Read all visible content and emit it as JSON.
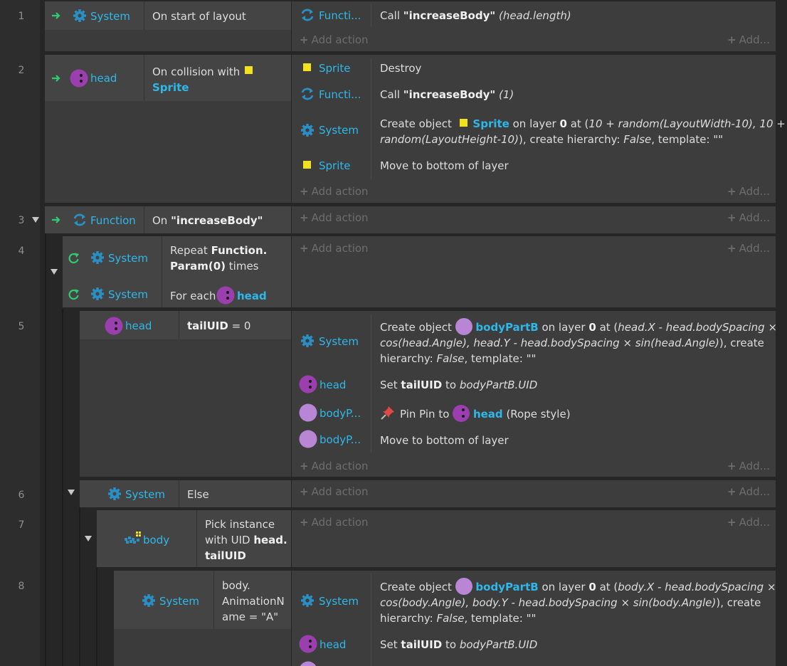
{
  "rows": [
    "1",
    "2",
    "3",
    "4",
    "5",
    "6",
    "7",
    "8"
  ],
  "objects": {
    "system": "System",
    "head": "head",
    "function": "Function",
    "functi": "Functi...",
    "sprite": "Sprite",
    "body": "body",
    "bodyp": "bodyP..."
  },
  "add_action": "Add action",
  "add_short": "Add...",
  "ev1": {
    "cond": "On start of layout",
    "act_call": "Call",
    "act_fn": "\"increaseBody\"",
    "act_arg": "(head.length)"
  },
  "ev2": {
    "cond_a": "On collision with",
    "cond_b": "Sprite",
    "a1": "Destroy",
    "a2_call": "Call",
    "a2_fn": "\"increaseBody\"",
    "a2_arg": "(1)",
    "a3_l1a": "Create object",
    "a3_obj": "Sprite",
    "a3_l1b": "on layer",
    "a3_layer": "0",
    "a3_l1c": "at (",
    "a3_l1d": "10 + random(LayoutWidth-10), 10 +",
    "a3_l2a": "random(LayoutHeight-10)",
    "a3_l2b": "), create hierarchy:",
    "a3_false": "False",
    "a3_l2c": ", template: \"\"",
    "a4": "Move to bottom of layer"
  },
  "ev3": {
    "cond_on": "On",
    "cond_fn": "\"increaseBody\""
  },
  "ev4": {
    "c1_a": "Repeat",
    "c1_b": "Function.",
    "c1_c": "Param(0)",
    "c1_d": "times",
    "c2_a": "For each"
  },
  "ev5": {
    "cond_var": "tailUID",
    "cond_rest": "= 0",
    "a1_l1a": "Create object",
    "a1_obj": "bodyPartB",
    "a1_l1b": "on layer",
    "a1_layer": "0",
    "a1_l1c": "at (",
    "a1_l1d": "head.X - head.bodySpacing ×",
    "a1_l2a": "cos(head.Angle), head.Y - head.bodySpacing × sin(head.Angle)",
    "a1_l2b": "), create",
    "a1_l3a": "hierarchy:",
    "a1_false": "False",
    "a1_l3b": ", template: \"\"",
    "a2_set": "Set",
    "a2_var": "tailUID",
    "a2_to": "to",
    "a2_val": "bodyPartB.UID",
    "a3_a": "Pin Pin to",
    "a3_b": "(Rope style)",
    "a4": "Move to bottom of layer"
  },
  "ev6": {
    "cond": "Else"
  },
  "ev7": {
    "c_a": "Pick instance",
    "c_b": "with UID",
    "c_c": "head.",
    "c_d": "tailUID"
  },
  "ev8": {
    "cond_l1": "body.",
    "cond_l2": "AnimationN",
    "cond_l3": "ame = \"A\"",
    "a1_l1a": "Create object",
    "a1_obj": "bodyPartB",
    "a1_l1b": "on layer",
    "a1_layer": "0",
    "a1_l1c": "at (",
    "a1_l1d": "body.X - head.bodySpacing ×",
    "a1_l2a": "cos(body.Angle), body.Y - head.bodySpacing × sin(body.Angle)",
    "a1_l2b": "), create",
    "a1_l3a": "hierarchy:",
    "a1_false": "False",
    "a1_l3b": ", template: \"\"",
    "a2_set": "Set",
    "a2_var": "tailUID",
    "a2_to": "to",
    "a2_val": "bodyPartB.UID"
  },
  "colors": {
    "accent": "#2eb8ea",
    "sprite_yellow": "#f2e21e",
    "head_purple": "#9b3fae",
    "body_lilac": "#b886d4",
    "trigger_green": "#2ecc71"
  },
  "icons": [
    "trigger-arrow-icon",
    "gear-icon",
    "function-loop-icon",
    "sprite-square-icon",
    "head-circle-icon",
    "body-circle-icon",
    "loop-icon",
    "pin-icon",
    "tilemap-icon",
    "collapse-triangle-icon"
  ]
}
